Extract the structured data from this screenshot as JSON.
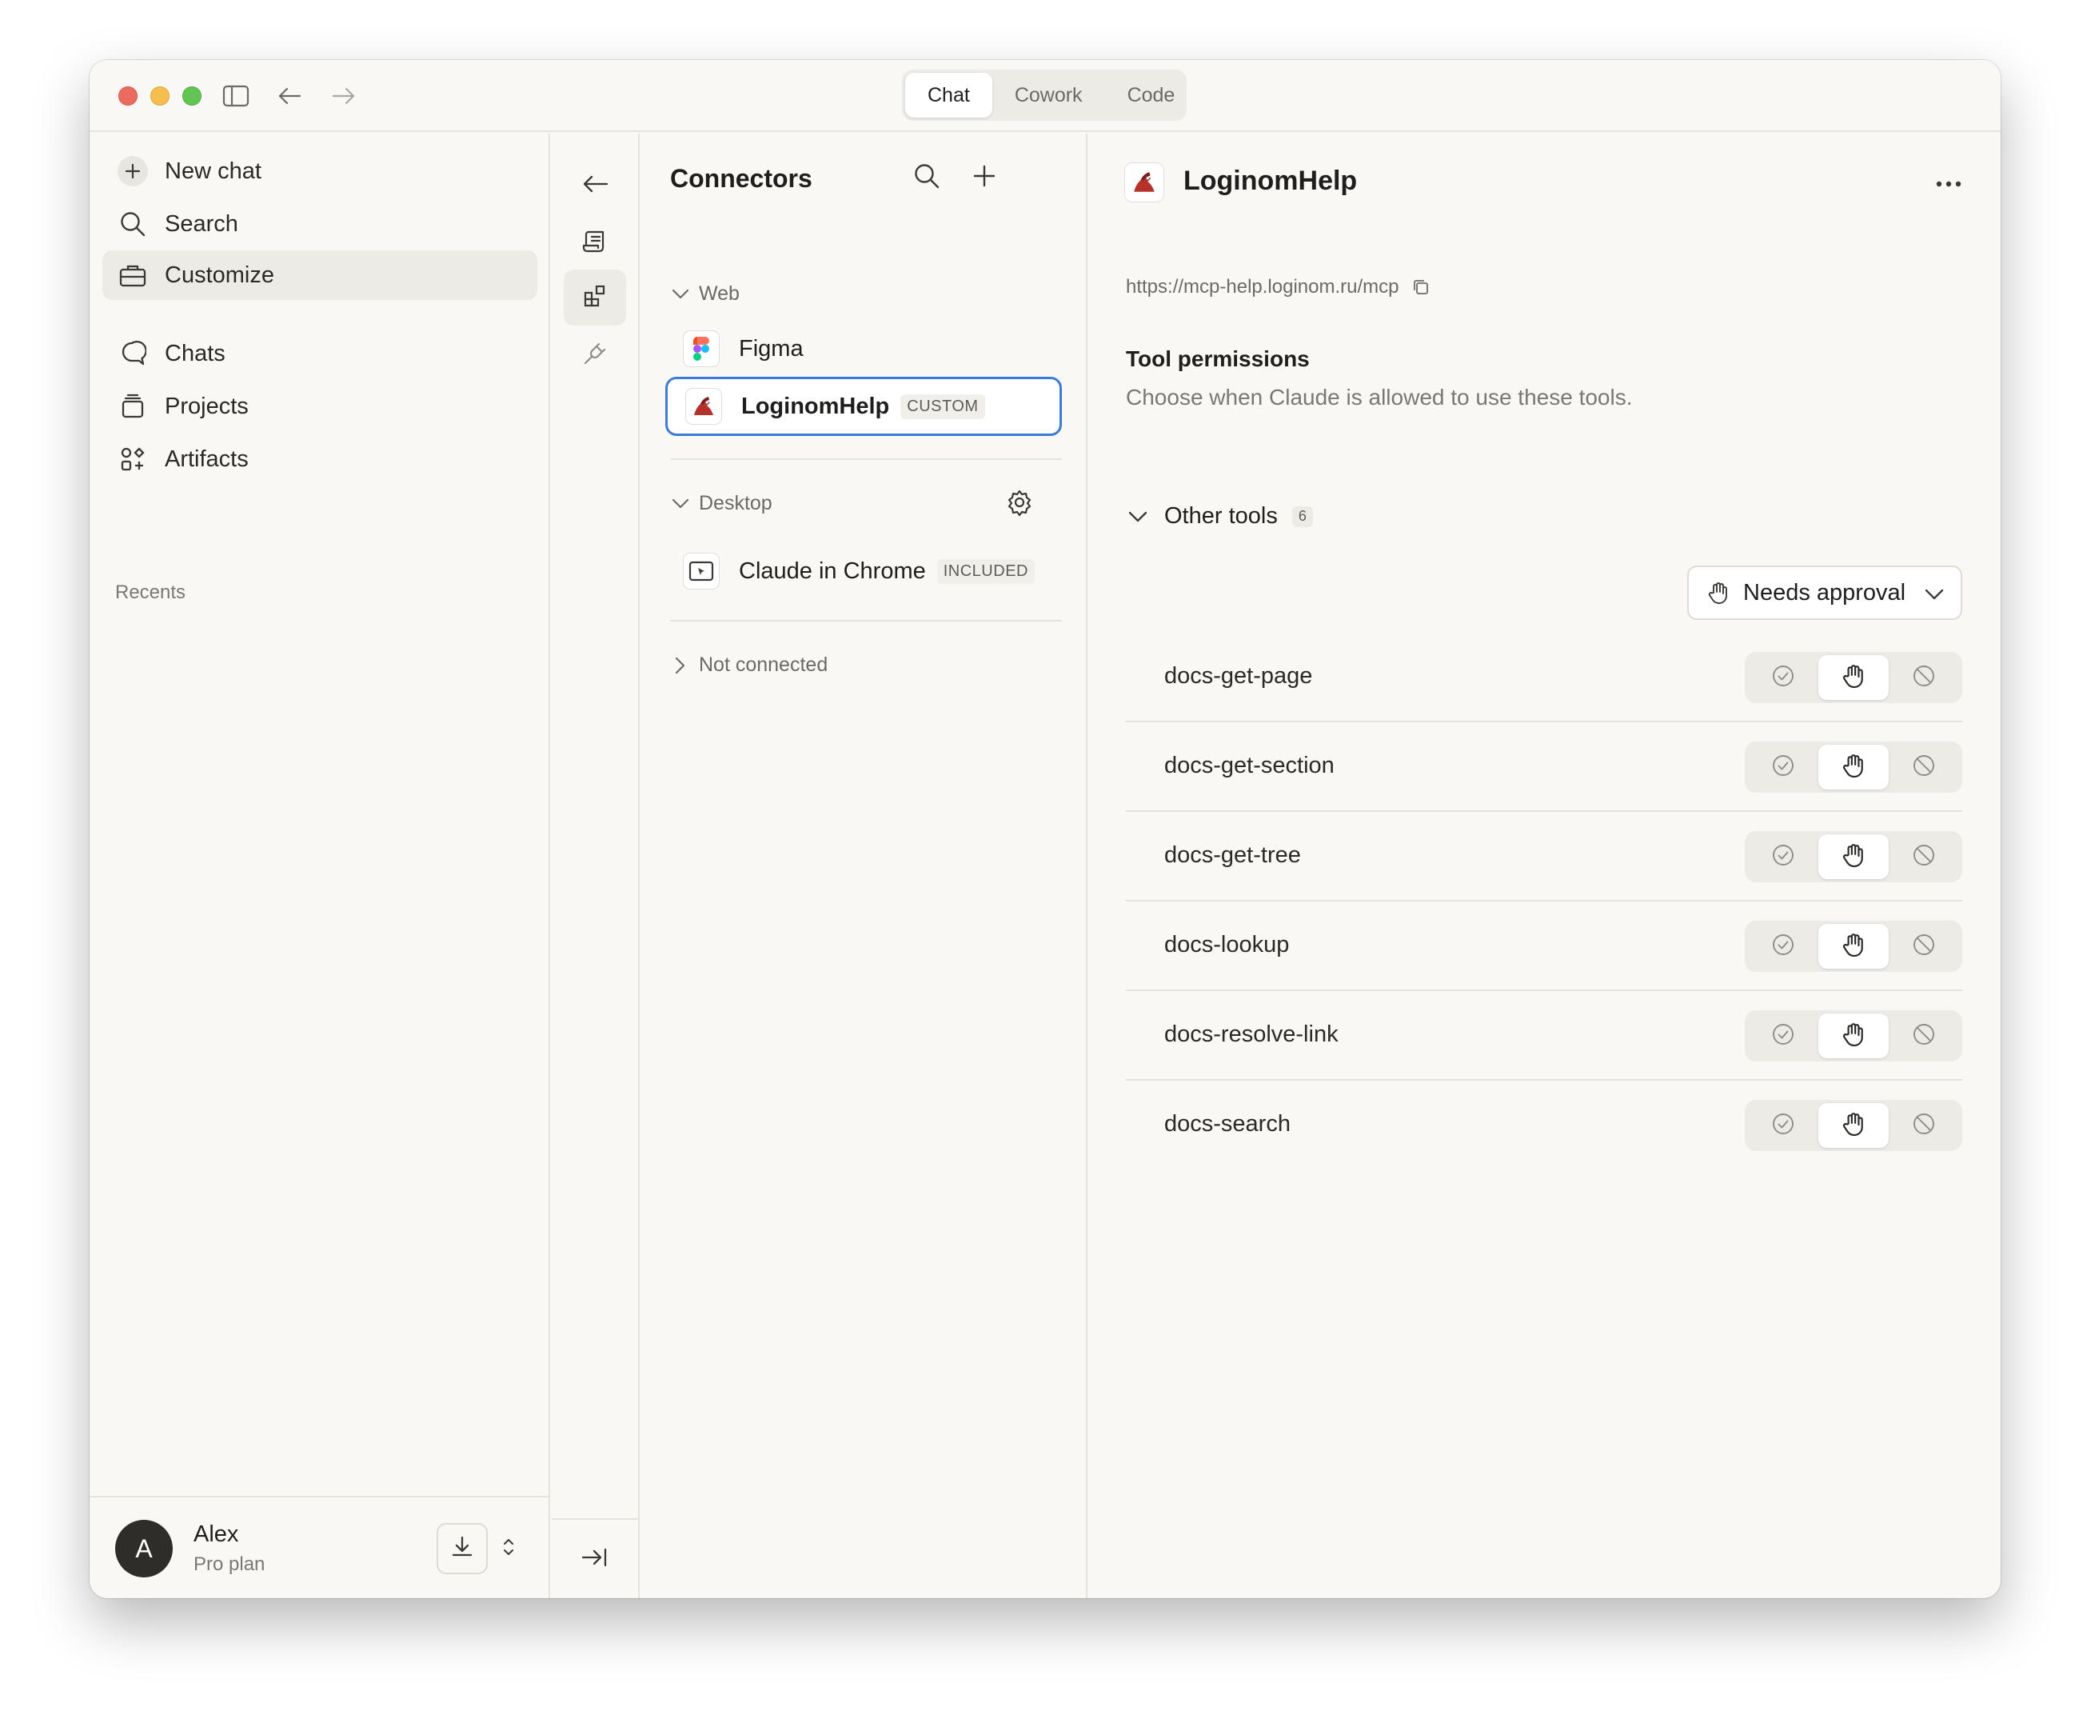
{
  "titlebar": {
    "modes": [
      "Chat",
      "Cowork",
      "Code"
    ],
    "active_mode": "Chat"
  },
  "sidebar": {
    "new_chat": "New chat",
    "search": "Search",
    "customize": "Customize",
    "chats": "Chats",
    "projects": "Projects",
    "artifacts": "Artifacts",
    "recents_label": "Recents",
    "user": {
      "initial": "A",
      "name": "Alex",
      "plan": "Pro plan"
    }
  },
  "connectors": {
    "title": "Connectors",
    "web_section": "Web",
    "web_items": [
      {
        "name": "Figma",
        "badge": ""
      },
      {
        "name": "LoginomHelp",
        "badge": "CUSTOM"
      }
    ],
    "desktop_section": "Desktop",
    "desktop_items": [
      {
        "name": "Claude in Chrome",
        "badge": "INCLUDED"
      }
    ],
    "not_connected": "Not connected"
  },
  "details": {
    "title": "LoginomHelp",
    "url": "https://mcp-help.loginom.ru/mcp",
    "permissions_heading": "Tool permissions",
    "permissions_description": "Choose when Claude is allowed to use these tools.",
    "group_label": "Other tools",
    "group_count": "6",
    "approval_value": "Needs approval",
    "tools": [
      {
        "name": "docs-get-page",
        "permission": "needs-approval"
      },
      {
        "name": "docs-get-section",
        "permission": "needs-approval"
      },
      {
        "name": "docs-get-tree",
        "permission": "needs-approval"
      },
      {
        "name": "docs-lookup",
        "permission": "needs-approval"
      },
      {
        "name": "docs-resolve-link",
        "permission": "needs-approval"
      },
      {
        "name": "docs-search",
        "permission": "needs-approval"
      }
    ]
  },
  "colors": {
    "background": "#f9f8f5",
    "selection_border": "#3c7bd8",
    "loginom_red": "#b4312c"
  }
}
